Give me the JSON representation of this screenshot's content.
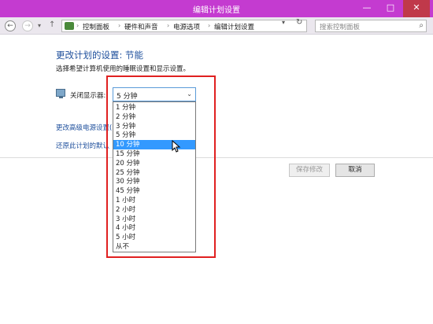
{
  "window": {
    "title": "编辑计划设置",
    "min": "—",
    "max": "□",
    "close": "✕"
  },
  "nav": {
    "back": "←",
    "forward": "→",
    "history": "▾",
    "up": "↑",
    "breadcrumbs": [
      "控制面板",
      "硬件和声音",
      "电源选项",
      "编辑计划设置"
    ],
    "separator": "›",
    "dropdown": "▾",
    "refresh": "↻",
    "search_placeholder": "搜索控制面板",
    "search_icon": "⌕"
  },
  "main": {
    "heading": "更改计划的设置: 节能",
    "subtext": "选择希望计算机使用的睡眠设置和显示设置。",
    "display_label": "关闭显示器:",
    "display_value": "5 分钟",
    "select_arrow": "⌄",
    "advanced_link": "更改高级电源设置(",
    "restore_link": "还原此计划的默认",
    "save_button": "保存修改",
    "cancel_button": "取消"
  },
  "dropdown": {
    "selected_index": 4,
    "options": [
      "1 分钟",
      "2 分钟",
      "3 分钟",
      "5 分钟",
      "10 分钟",
      "15 分钟",
      "20 分钟",
      "25 分钟",
      "30 分钟",
      "45 分钟",
      "1 小时",
      "2 小时",
      "3 小时",
      "4 小时",
      "5 小时",
      "从不"
    ]
  },
  "colors": {
    "titlebar": "#c43bd0",
    "link": "#1e4f9c",
    "selection": "#3399ff",
    "annotation": "#e02020"
  }
}
